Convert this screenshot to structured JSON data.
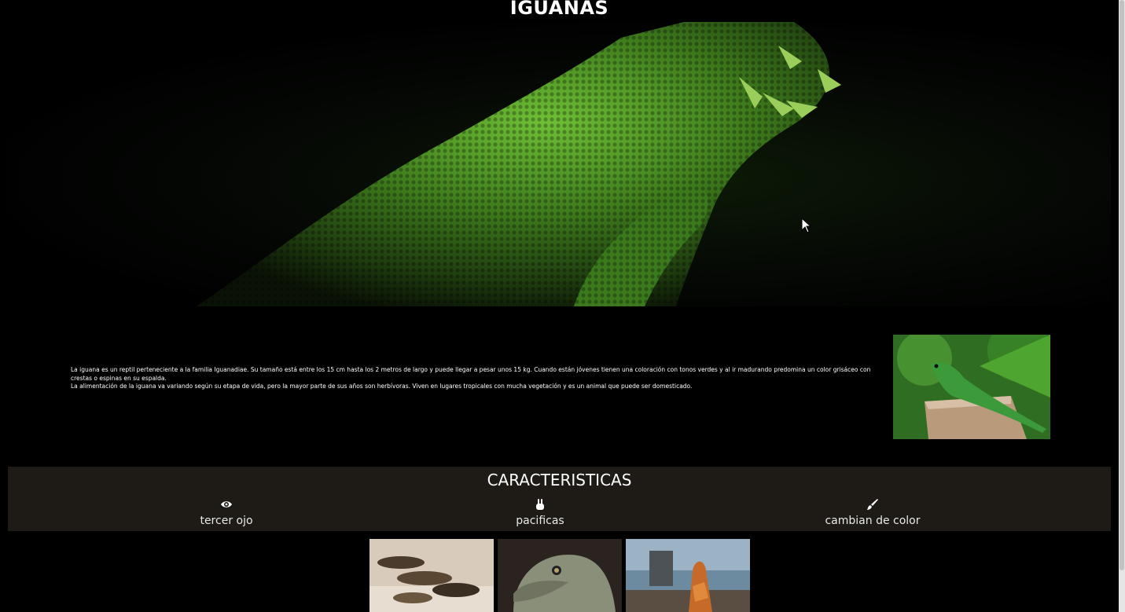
{
  "header": {
    "title": "IGUANAS"
  },
  "intro": {
    "paragraph_1": "La iguana es un reptil perteneciente a la familia Iguanadiae. Su tamaño está entre los 15 cm hasta los 2 metros de largo y puede llegar a pesar unos 15 kg. Cuando están jóvenes tienen una coloración con tonos verdes y al ir madurando predomina un color grisáceo con crestas o espinas en su espalda.",
    "paragraph_2": "La alimentación de la iguana va variando según su etapa de vida, pero la mayor parte de sus años son herbívoras. Viven en lugares tropicales con mucha vegetación y es un animal que puede ser domesticado."
  },
  "features": {
    "title": "CARACTERISTICAS",
    "items": [
      {
        "label": "tercer ojo",
        "icon": "eye-icon"
      },
      {
        "label": "pacificas",
        "icon": "peace-hand-icon"
      },
      {
        "label": "cambian de color",
        "icon": "paint-brush-icon"
      }
    ]
  },
  "gallery": {
    "images": [
      {
        "subject": "iguanas-on-sand"
      },
      {
        "subject": "iguana-head-closeup"
      },
      {
        "subject": "iguana-on-dock"
      }
    ]
  },
  "colors": {
    "background": "#000000",
    "features_band": "#1e1b17",
    "lizard_green": "#4f9a2a"
  }
}
